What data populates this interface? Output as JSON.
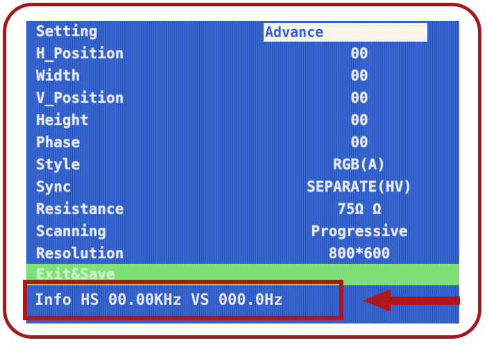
{
  "header": {
    "label": "Setting",
    "selected_tab": "Advance"
  },
  "rows": [
    {
      "label": "H_Position",
      "value": "00"
    },
    {
      "label": "Width",
      "value": "00"
    },
    {
      "label": "V_Position",
      "value": "00"
    },
    {
      "label": "Height",
      "value": "00"
    },
    {
      "label": "Phase",
      "value": "00"
    },
    {
      "label": "Style",
      "value": "RGB(A)"
    },
    {
      "label": "Sync",
      "value": "SEPARATE(HV)"
    },
    {
      "label": "Resistance",
      "value": "75Ω Ω"
    },
    {
      "label": "Scanning",
      "value": "Progressive"
    },
    {
      "label": "Resolution",
      "value": "800*600"
    }
  ],
  "exit": {
    "label": "Exit&Save"
  },
  "info": {
    "text": "Info HS 00.00KHz VS 000.0Hz"
  },
  "colors": {
    "screen": "#2f5fd0",
    "highlight": "#7fe07a",
    "annotation": "#b0161c",
    "text": "#e8eaf2"
  }
}
